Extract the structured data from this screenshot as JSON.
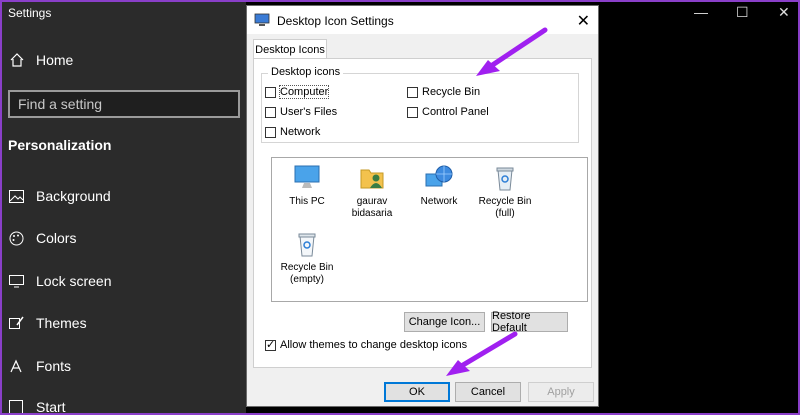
{
  "settings": {
    "title": "Settings",
    "home": "Home",
    "search_placeholder": "Find a setting",
    "section": "Personalization",
    "nav": [
      "Background",
      "Colors",
      "Lock screen",
      "Themes",
      "Fonts",
      "Start"
    ]
  },
  "dialog": {
    "title": "Desktop Icon Settings",
    "close": "✕",
    "tab": "Desktop Icons",
    "group_label": "Desktop icons",
    "checkboxes": [
      {
        "label": "Computer",
        "checked": false
      },
      {
        "label": "User's Files",
        "checked": false
      },
      {
        "label": "Network",
        "checked": false
      },
      {
        "label": "Recycle Bin",
        "checked": false
      },
      {
        "label": "Control Panel",
        "checked": false
      }
    ],
    "icons": [
      {
        "name": "This PC",
        "line2": ""
      },
      {
        "name": "gaurav",
        "line2": "bidasaria"
      },
      {
        "name": "Network",
        "line2": ""
      },
      {
        "name": "Recycle Bin",
        "line2": "(full)"
      },
      {
        "name": "Recycle Bin",
        "line2": "(empty)"
      }
    ],
    "change_icon": "Change Icon...",
    "restore_default": "Restore Default",
    "allow_themes": "Allow themes to change desktop icons",
    "allow_themes_checked": true,
    "ok": "OK",
    "cancel": "Cancel",
    "apply": "Apply"
  },
  "colors": {
    "accent_arrow": "#a020f0",
    "frame": "#8a3fc9"
  }
}
